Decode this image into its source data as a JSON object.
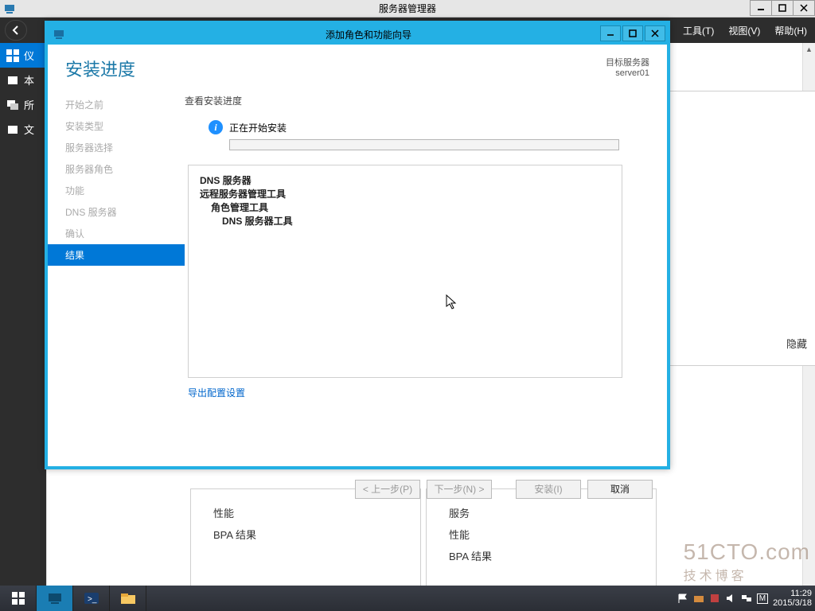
{
  "outer": {
    "title": "服务器管理器",
    "menu": {
      "tools": "工具(T)",
      "view": "视图(V)",
      "help": "帮助(H)"
    }
  },
  "sidebar": {
    "items": [
      {
        "label": "仪"
      },
      {
        "label": "本"
      },
      {
        "label": "所"
      },
      {
        "label": "文"
      }
    ]
  },
  "tiles": {
    "left": {
      "perf": "性能",
      "bpa": "BPA 结果"
    },
    "right": {
      "svc": "服务",
      "perf": "性能",
      "bpa": "BPA 结果"
    },
    "hide": "隐藏"
  },
  "wizard": {
    "title": "添加角色和功能向导",
    "heading": "安装进度",
    "target_label": "目标服务器",
    "target_value": "server01",
    "steps": [
      "开始之前",
      "安装类型",
      "服务器选择",
      "服务器角色",
      "功能",
      "DNS 服务器",
      "确认",
      "结果"
    ],
    "active_step": 7,
    "subhead": "查看安装进度",
    "status": "正在开始安装",
    "features": {
      "l0a": "DNS 服务器",
      "l0b": "远程服务器管理工具",
      "l1": "角色管理工具",
      "l2": "DNS 服务器工具"
    },
    "export_link": "导出配置设置",
    "buttons": {
      "prev": "< 上一步(P)",
      "next": "下一步(N) >",
      "install": "安装(I)",
      "cancel": "取消"
    }
  },
  "taskbar": {
    "time": "11:29",
    "date": "2015/3/18"
  },
  "watermark": {
    "line1": "51CTO.com",
    "line2": "技术博客"
  }
}
